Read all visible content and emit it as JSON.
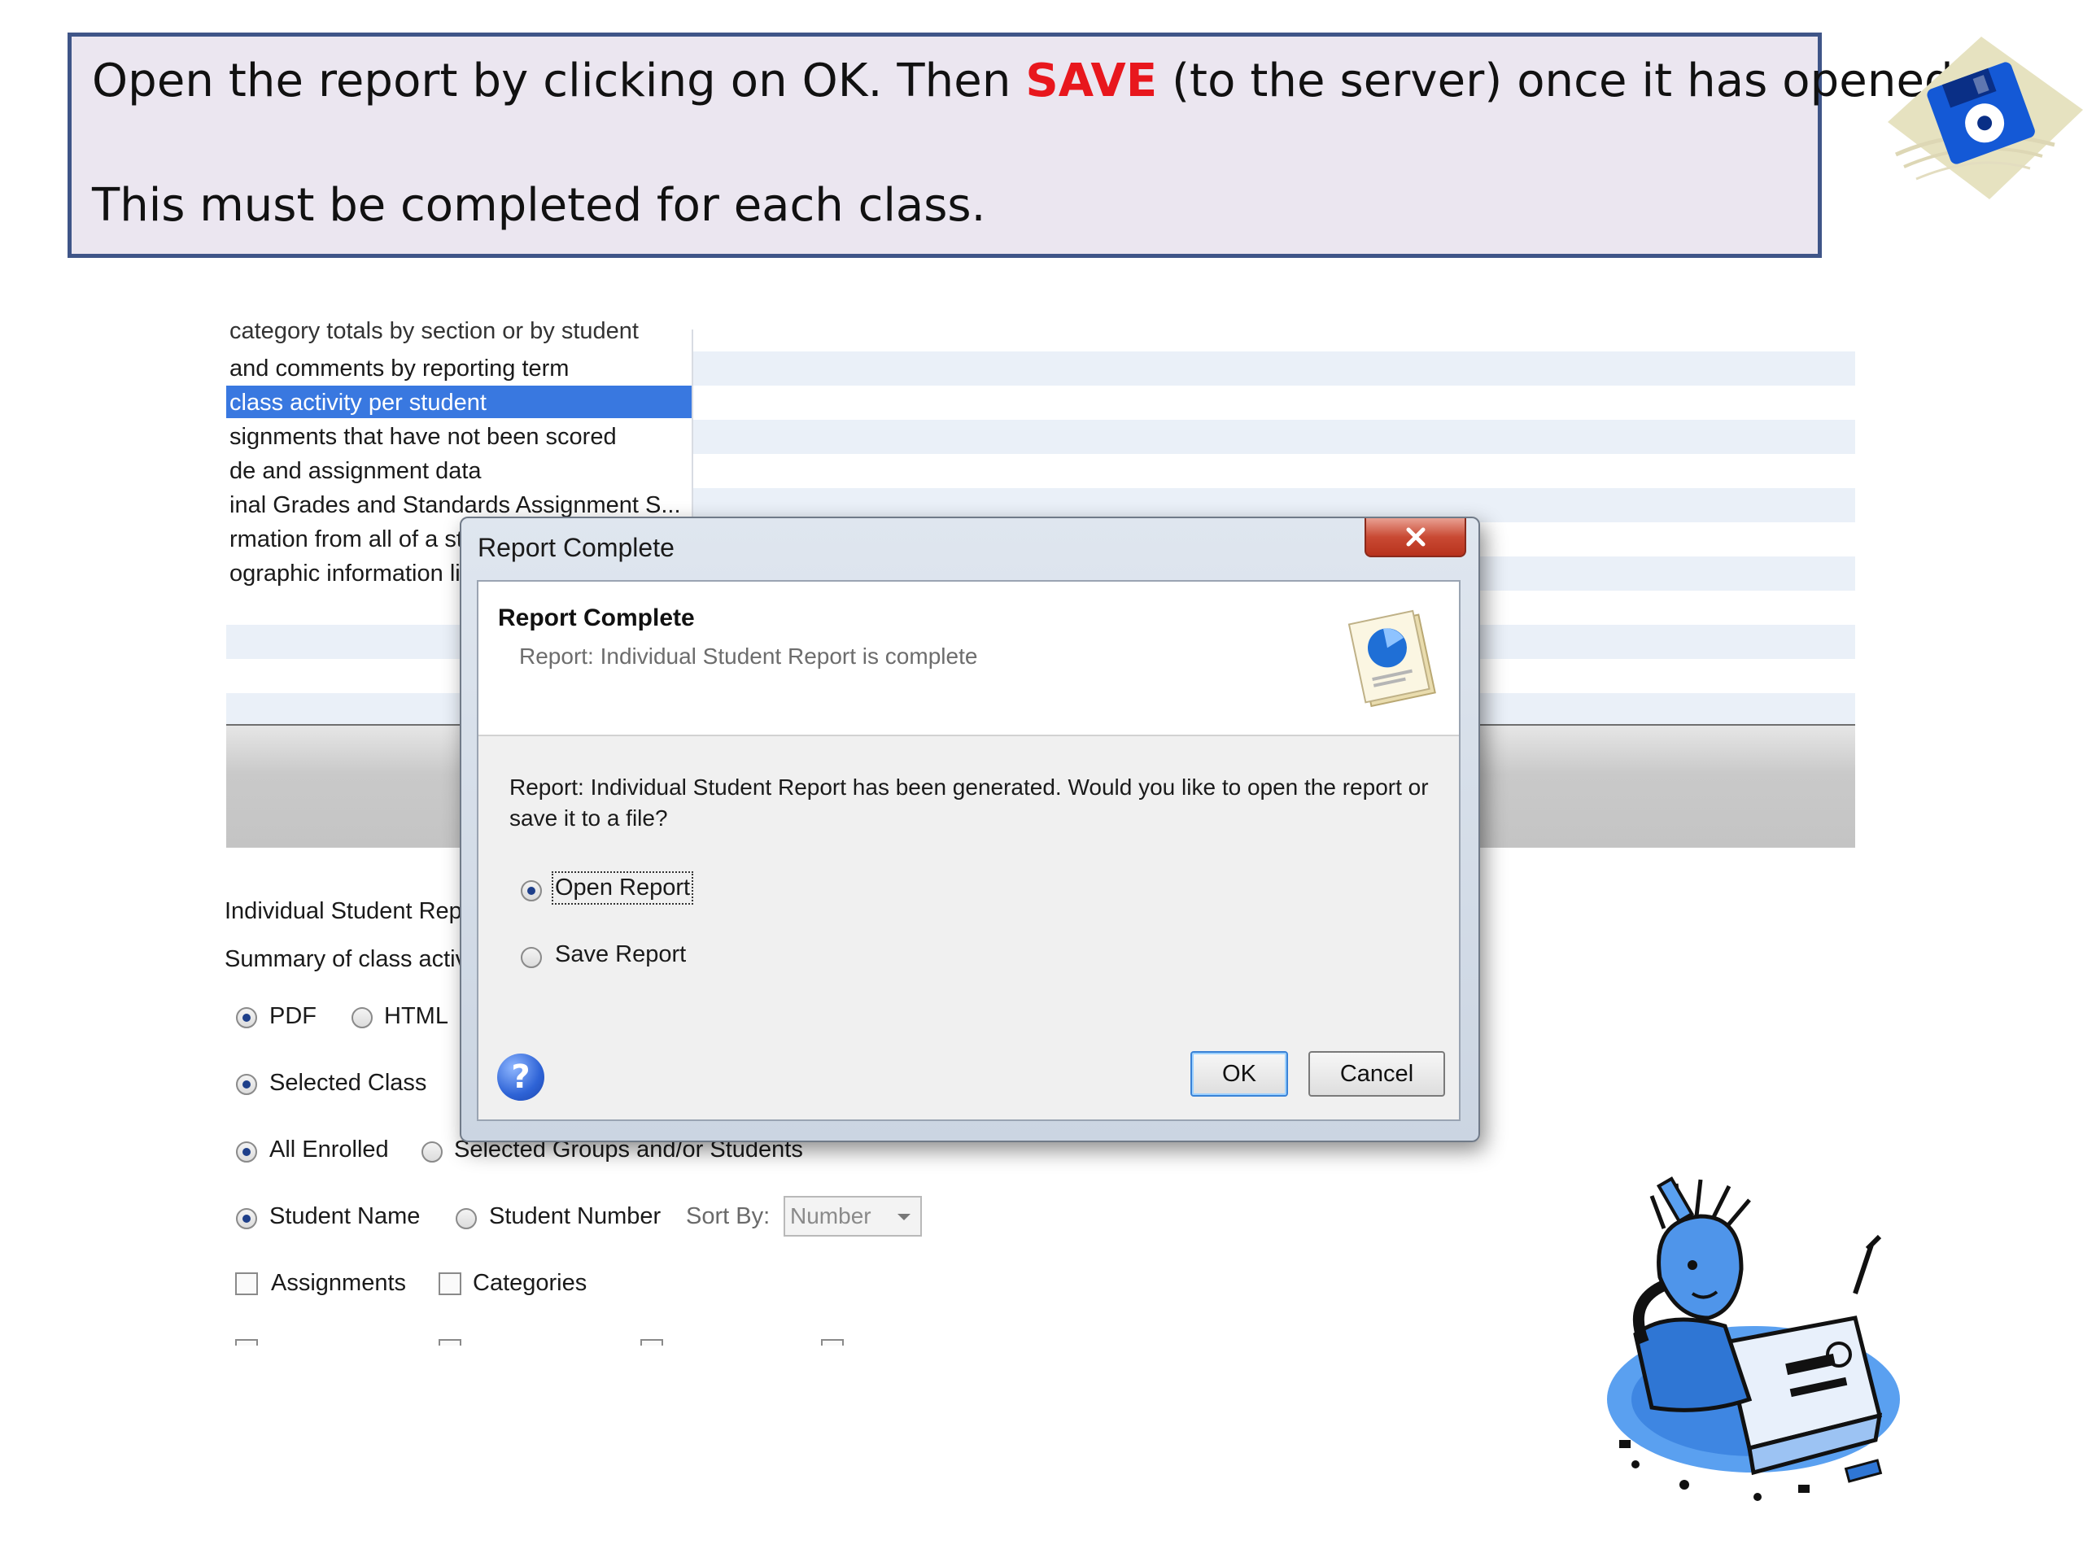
{
  "instruction": {
    "line1_pre": "Open the report by clicking on OK.  Then ",
    "line1_save": "SAVE",
    "line1_post": " (to the server) once it has opened.",
    "line2": "This must be completed for each class."
  },
  "report_list": {
    "items": [
      "category totals by section or by student",
      "and comments by reporting term",
      "class activity per student",
      "signments that have not been scored",
      "de and assignment data",
      "inal Grades and Standards Assignment S...",
      "rmation from all of a st",
      "ographic information li"
    ],
    "selected_index": 2
  },
  "options": {
    "report_name": "Individual Student Rep",
    "report_desc": "Summary of class activ",
    "format_pdf": "PDF",
    "format_html": "HTML",
    "selected_class": "Selected Class",
    "all_enrolled": "All Enrolled",
    "selected_groups": "Selected Groups and/or Students",
    "student_name": "Student Name",
    "student_number": "Student Number",
    "sort_by_label": "Sort By:",
    "sort_by_value": "Number",
    "assignments": "Assignments",
    "categories": "Categories"
  },
  "dialog": {
    "title": "Report Complete",
    "heading": "Report Complete",
    "subheading": "Report: Individual Student Report is complete",
    "message": "Report: Individual Student Report has been generated. Would you like to open the report or save it to a file?",
    "option_open": "Open Report",
    "option_save": "Save Report",
    "selected_option": "open",
    "ok_label": "OK",
    "cancel_label": "Cancel",
    "help_glyph": "?"
  },
  "colors": {
    "accent_save": "#e8171d",
    "banner_border": "#3f5588",
    "selection": "#3978e0"
  },
  "icons": [
    "floppy-disk-icon",
    "close-icon",
    "report-document-icon",
    "help-icon",
    "frustrated-user-illustration"
  ]
}
